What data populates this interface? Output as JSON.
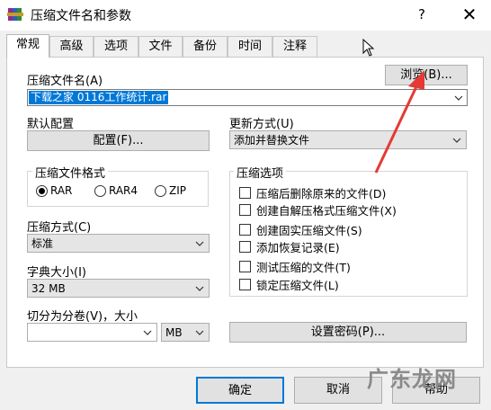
{
  "window": {
    "title": "压缩文件名和参数",
    "help_label": "?",
    "close_label": "✕",
    "app_icon": "winrar-books-icon"
  },
  "tabs": [
    {
      "label": "常规",
      "active": true
    },
    {
      "label": "高级"
    },
    {
      "label": "选项"
    },
    {
      "label": "文件"
    },
    {
      "label": "备份"
    },
    {
      "label": "时间"
    },
    {
      "label": "注释"
    }
  ],
  "archive_name": {
    "label": "压缩文件名(A)",
    "value": "下载之家 0116工作统计.rar",
    "browse_label": "浏览(B)..."
  },
  "default_profile": {
    "label": "默认配置",
    "button_label": "配置(F)..."
  },
  "update_mode": {
    "label": "更新方式(U)",
    "value": "添加并替换文件"
  },
  "archive_format": {
    "label": "压缩文件格式",
    "options": [
      "RAR",
      "RAR4",
      "ZIP"
    ],
    "selected": "RAR"
  },
  "compression_method": {
    "label": "压缩方式(C)",
    "value": "标准"
  },
  "dictionary_size": {
    "label": "字典大小(I)",
    "value": "32 MB"
  },
  "split_volumes": {
    "label": "切分为分卷(V)，大小",
    "value": "",
    "unit": "MB"
  },
  "archiving_options": {
    "label": "压缩选项",
    "items": [
      "压缩后删除原来的文件(D)",
      "创建自解压格式压缩文件(X)",
      "创建固实压缩文件(S)",
      "添加恢复记录(E)",
      "测试压缩的文件(T)",
      "锁定压缩文件(L)"
    ]
  },
  "set_password_label": "设置密码(P)...",
  "buttons": {
    "ok": "确定",
    "cancel": "取消",
    "help": "帮助"
  },
  "watermark": "广东龙网",
  "colors": {
    "selection": "#0078d7",
    "arrow": "#e53935"
  }
}
